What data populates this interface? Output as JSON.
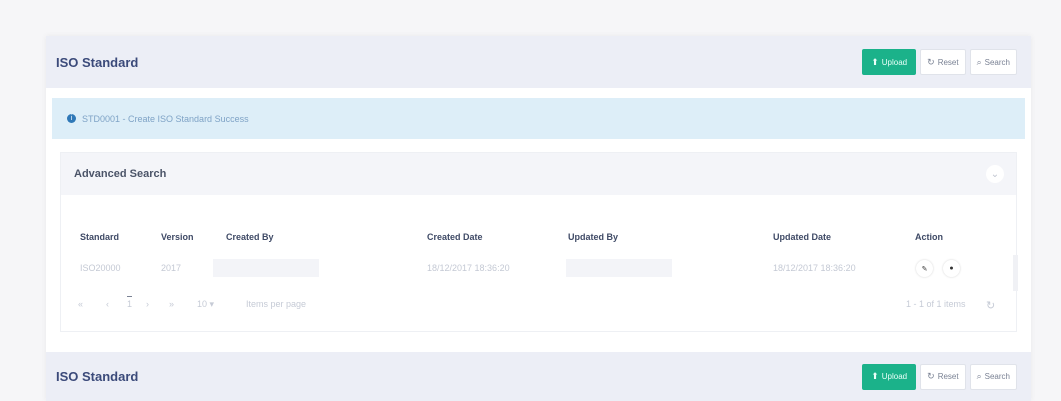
{
  "header": {
    "title": "ISO Standard",
    "buttons": {
      "upload": "Upload",
      "reset": "Reset",
      "search": "Search"
    }
  },
  "info": {
    "text": "STD0001 - Create ISO Standard Success"
  },
  "advanced_search": {
    "title": "Advanced Search",
    "toggle_icon": "chevron-down"
  },
  "table": {
    "headers": [
      "Standard",
      "Version",
      "Created By",
      "Created Date",
      "Updated By",
      "Updated Date",
      "Action"
    ],
    "rows": [
      {
        "standard": "ISO20000",
        "version": "2017",
        "created_by": "",
        "created_date": "18/12/2017 18:36:20",
        "updated_by": "",
        "updated_date": "18/12/2017 18:36:20"
      }
    ],
    "action_icons": [
      "edit-icon",
      "delete-icon"
    ]
  },
  "pagination": {
    "first": "«",
    "prev": "‹",
    "current_page": "1",
    "next": "›",
    "last": "»",
    "page_size": "10",
    "items_per_page_label": "Items per page",
    "range_text": "1 - 1 of 1 items",
    "refresh_icon": "refresh"
  },
  "footer_header": {
    "title": "ISO Standard",
    "buttons": {
      "upload": "Upload",
      "reset": "Reset",
      "search": "Search"
    }
  },
  "colors": {
    "primary": "#1bb28a",
    "header_bg": "#eceef6",
    "info_bg": "#ddeef8",
    "title": "#3b4a7a"
  }
}
